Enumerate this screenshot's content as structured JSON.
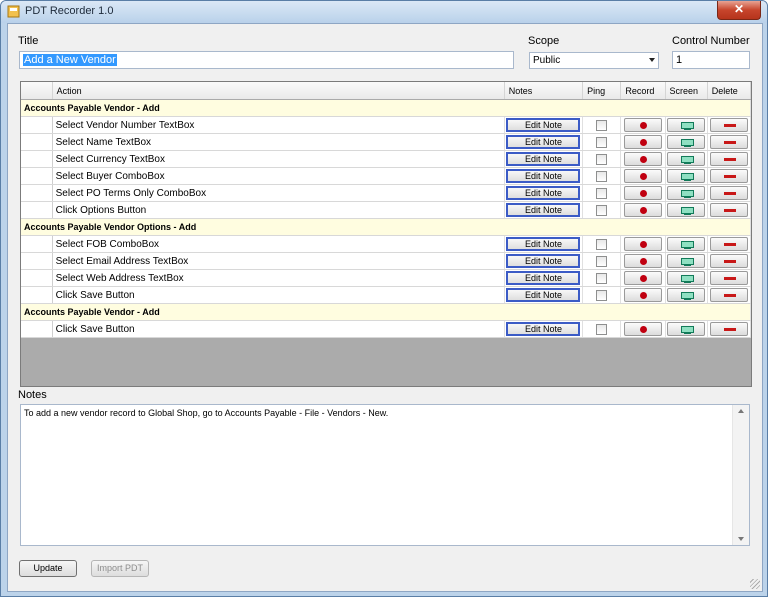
{
  "window": {
    "title": "PDT Recorder 1.0",
    "close_label": "✕"
  },
  "form": {
    "title_label": "Title",
    "title_value": "Add a New Vendor",
    "scope_label": "Scope",
    "scope_value": "Public",
    "control_number_label": "Control Number",
    "control_number_value": "1"
  },
  "grid": {
    "columns": [
      "Action",
      "Notes",
      "Ping",
      "Record",
      "Screen",
      "Delete"
    ],
    "edit_note_label": "Edit Note",
    "sections": [
      {
        "title": "Accounts Payable Vendor - Add",
        "rows": [
          "Select Vendor Number TextBox",
          "Select Name TextBox",
          "Select Currency TextBox",
          "Select Buyer ComboBox",
          "Select PO Terms Only ComboBox",
          "Click Options Button"
        ]
      },
      {
        "title": "Accounts Payable Vendor Options - Add",
        "rows": [
          "Select FOB ComboBox",
          "Select Email Address TextBox",
          "Select Web Address TextBox",
          "Click Save Button"
        ]
      },
      {
        "title": "Accounts Payable Vendor - Add",
        "rows": [
          "Click Save Button"
        ]
      }
    ]
  },
  "notes": {
    "label": "Notes",
    "text": "To add a new vendor record to Global Shop, go to Accounts Payable - File - Vendors - New."
  },
  "buttons": {
    "update": "Update",
    "import": "Import PDT"
  },
  "colors": {
    "record": "#c00010",
    "delete": "#c81818",
    "screen": "#127a59",
    "section_bg": "#fffde0",
    "edit_border": "#3b5bc6"
  },
  "icons": {
    "record": "record-dot-icon",
    "screen": "monitor-icon",
    "delete": "minus-icon"
  }
}
